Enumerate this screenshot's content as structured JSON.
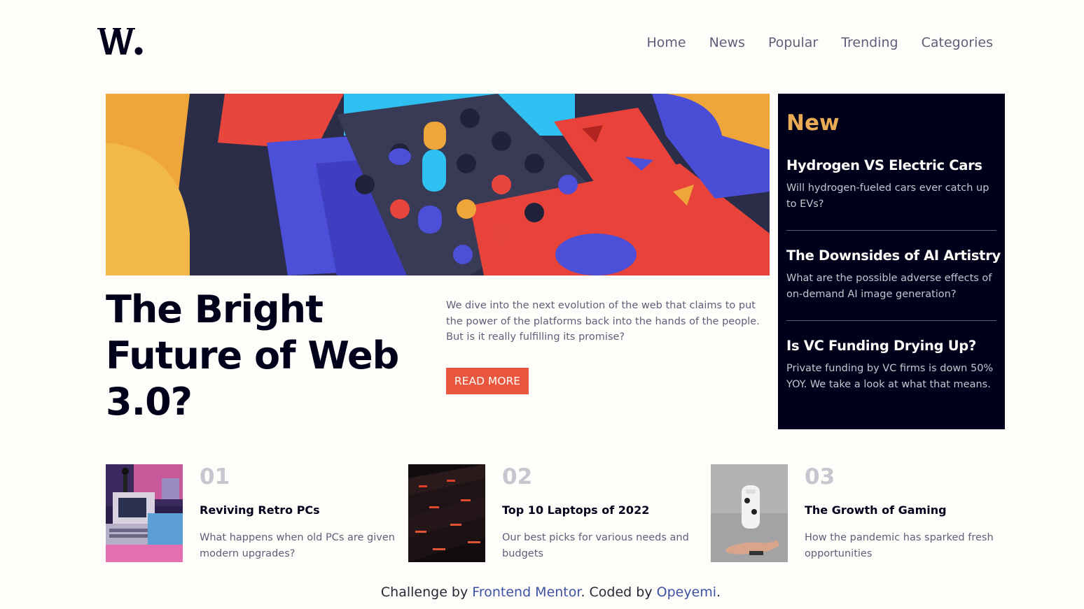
{
  "logo": {
    "text": "W."
  },
  "nav": {
    "items": [
      "Home",
      "News",
      "Popular",
      "Trending",
      "Categories"
    ]
  },
  "hero": {
    "title": "The Bright Future of Web 3.0?",
    "description": "We dive into the next evolution of the web that claims to put the power of the platforms back into the hands of the people. But is it really fulfilling its promise?",
    "button_label": "READ MORE"
  },
  "new_panel": {
    "heading": "New",
    "items": [
      {
        "title": "Hydrogen VS Electric Cars",
        "description": "Will hydrogen-fueled cars ever catch up to EVs?"
      },
      {
        "title": "The Downsides of AI Artistry",
        "description": "What are the possible adverse effects of on-demand AI image generation?"
      },
      {
        "title": "Is VC Funding Drying Up?",
        "description": "Private funding by VC firms is down 50% YOY. We take a look at what that means."
      }
    ]
  },
  "cards": [
    {
      "number": "01",
      "title": "Reviving Retro PCs",
      "description": "What happens when old PCs are given modern upgrades?"
    },
    {
      "number": "02",
      "title": "Top 10 Laptops of 2022",
      "description": "Our best picks for various needs and budgets"
    },
    {
      "number": "03",
      "title": "The Growth of Gaming",
      "description": "How the pandemic has sparked fresh opportunities"
    }
  ],
  "footer": {
    "prefix": "Challenge by ",
    "link1": "Frontend Mentor",
    "middle": ". Coded by ",
    "link2": "Opeyemi",
    "suffix": "."
  },
  "colors": {
    "soft_red": "#e9563f",
    "soft_orange": "#e9ab53",
    "very_dark_blue": "#00001a",
    "dark_grayish_blue": "#5d5f79",
    "grayish_blue": "#c5c6ce",
    "off_white": "#fffdfa"
  }
}
